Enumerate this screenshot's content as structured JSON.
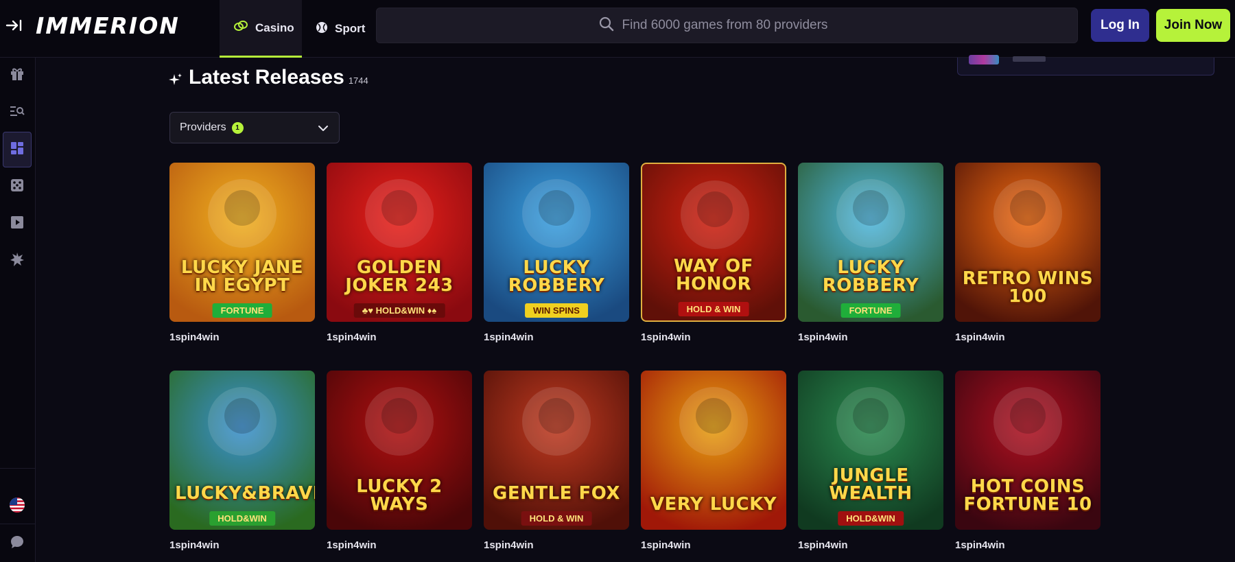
{
  "header": {
    "logo": "IMMERION",
    "tabs": [
      {
        "label": "Casino",
        "active": true
      },
      {
        "label": "Sport",
        "active": false
      }
    ],
    "search": {
      "placeholder": "Find 6000 games from 80 providers"
    },
    "login_label": "Log In",
    "join_label": "Join Now",
    "colors": {
      "accent": "#b6f23a",
      "login_bg": "#2f2e8f",
      "bg": "#08070f"
    }
  },
  "sidebar": {
    "items": [
      {
        "icon": "gift-icon"
      },
      {
        "icon": "search-list-icon"
      },
      {
        "icon": "grid-icon",
        "active": true
      },
      {
        "icon": "dice-icon"
      },
      {
        "icon": "play-icon"
      },
      {
        "icon": "burst-icon"
      }
    ],
    "bottom": [
      {
        "icon": "us-flag-icon"
      },
      {
        "icon": "chat-icon"
      }
    ]
  },
  "section": {
    "title": "Latest Releases",
    "count": "1744",
    "filter_label": "Providers",
    "filter_badge": "1"
  },
  "games": [
    {
      "title": "LUCKY JANE IN EGYPT",
      "tag": "FORTUNE",
      "provider": "1spin4win",
      "colors": [
        "#f0b020",
        "#b85a10"
      ]
    },
    {
      "title": "GOLDEN JOKER 243",
      "tag": "♣♥ HOLD&WIN ♦♠",
      "provider": "1spin4win",
      "colors": [
        "#e8201a",
        "#8a0a10"
      ]
    },
    {
      "title": "LUCKY ROBBERY",
      "tag": "WIN SPINS",
      "provider": "1spin4win",
      "colors": [
        "#3aa0e0",
        "#1a4a80"
      ]
    },
    {
      "title": "WAY OF HONOR",
      "tag": "HOLD & WIN",
      "provider": "1spin4win",
      "colors": [
        "#d02010",
        "#601008"
      ]
    },
    {
      "title": "LUCKY ROBBERY",
      "tag": "FORTUNE",
      "provider": "1spin4win",
      "colors": [
        "#50b8e0",
        "#2a5a30"
      ]
    },
    {
      "title": "RETRO WINS 100",
      "tag": "",
      "provider": "1spin4win",
      "colors": [
        "#f06a10",
        "#501408"
      ]
    },
    {
      "title": "LUCKY&BRAVE",
      "tag": "HOLD&WIN",
      "provider": "1spin4win",
      "colors": [
        "#3a90d0",
        "#2a6a20"
      ]
    },
    {
      "title": "LUCKY 2 WAYS",
      "tag": "",
      "provider": "1spin4win",
      "colors": [
        "#b01010",
        "#4a0608"
      ]
    },
    {
      "title": "GENTLE FOX",
      "tag": "HOLD & WIN",
      "provider": "1spin4win",
      "colors": [
        "#c03a20",
        "#501008"
      ]
    },
    {
      "title": "VERY LUCKY",
      "tag": "",
      "provider": "1spin4win",
      "colors": [
        "#e8a010",
        "#a01808"
      ]
    },
    {
      "title": "JUNGLE WEALTH",
      "tag": "HOLD&WIN",
      "provider": "1spin4win",
      "colors": [
        "#2a8a50",
        "#103a20"
      ]
    },
    {
      "title": "HOT COINS FORTUNE 10",
      "tag": "",
      "provider": "1spin4win",
      "colors": [
        "#b01020",
        "#3a0610"
      ]
    }
  ]
}
